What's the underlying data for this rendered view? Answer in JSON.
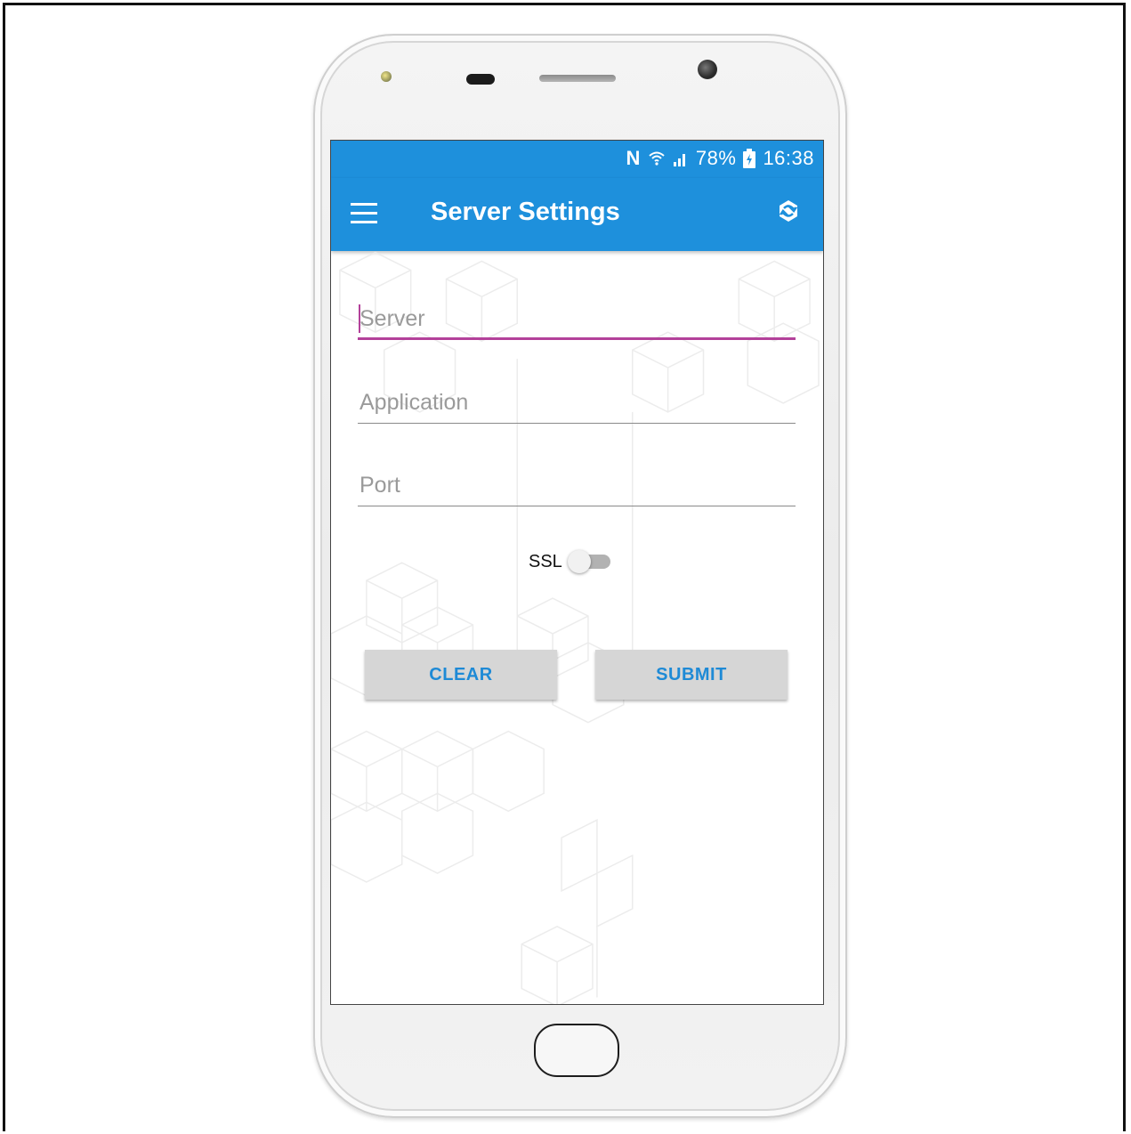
{
  "status_bar": {
    "icons": [
      "nfc-icon",
      "wifi-icon",
      "signal-icon",
      "battery-icon"
    ],
    "nfc": "N",
    "battery": "78%",
    "time": "16:38"
  },
  "app_bar": {
    "title": "Server Settings",
    "left_icon": "menu-icon",
    "right_icon": "sync-icon",
    "color": "#1e90dc"
  },
  "form": {
    "server": {
      "placeholder": "Server",
      "value": ""
    },
    "application": {
      "placeholder": "Application",
      "value": ""
    },
    "port": {
      "placeholder": "Port",
      "value": ""
    },
    "ssl": {
      "label": "SSL",
      "enabled": false
    },
    "focus_color": "#b3419a"
  },
  "buttons": {
    "clear": "CLEAR",
    "submit": "SUBMIT",
    "text_color": "#1e8ad6"
  }
}
